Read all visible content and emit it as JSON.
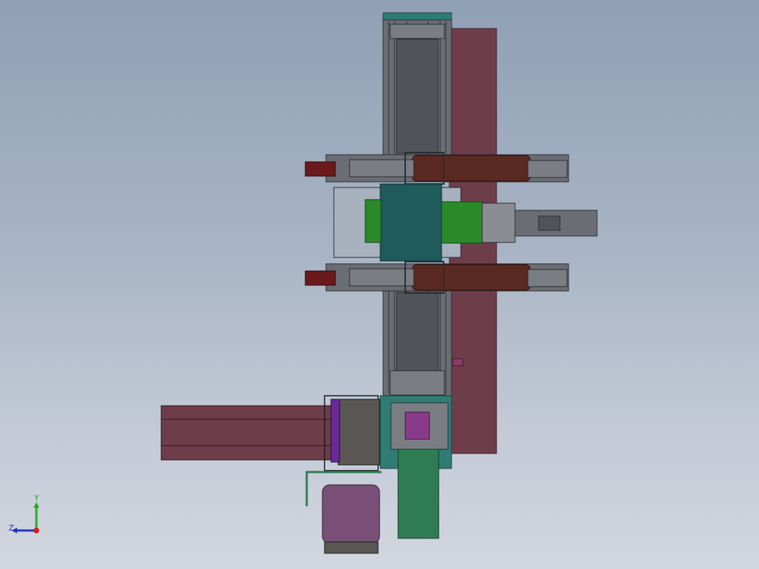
{
  "viewport": {
    "background_top": "#8fa0b5",
    "background_bottom": "#d2d6df"
  },
  "triad": {
    "y_label": "Y",
    "z_label": "Z",
    "x_color": "#cc2222",
    "y_color": "#22aa22",
    "z_color": "#2233bb"
  },
  "parts": {
    "frame_plate_color": "#6e3d4a",
    "rail_color": "#5b5f64",
    "base_teal": "#2f7c74",
    "carriage_teal": "#1f5a5c",
    "green_bracket": "#2a8a2a",
    "cylinder_brown": "#5a2a22",
    "motor_purple": "#7a4f78",
    "accent_purple": "#6a2a7a"
  }
}
